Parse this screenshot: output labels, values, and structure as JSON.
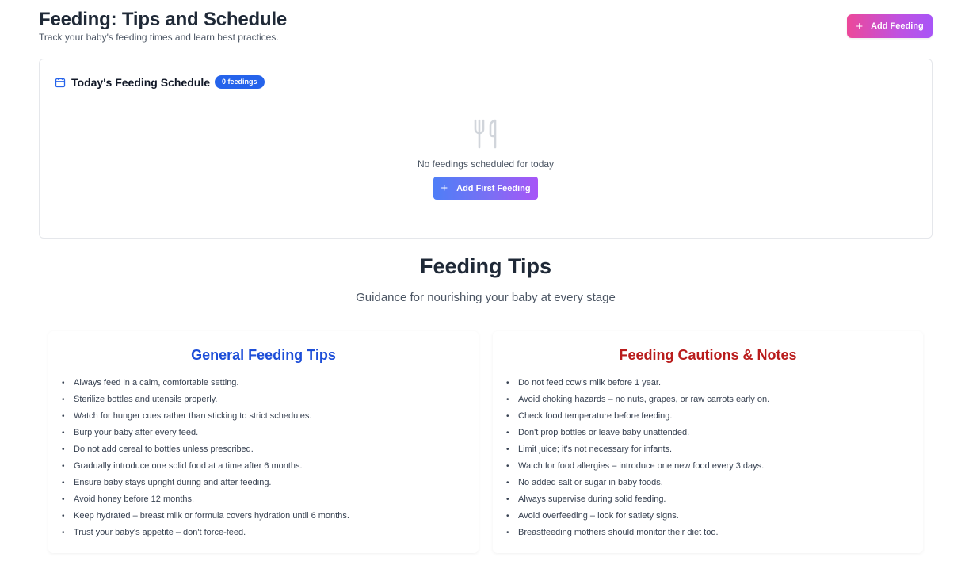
{
  "header": {
    "title": "Feeding: Tips and Schedule",
    "subtitle": "Track your baby's feeding times and learn best practices.",
    "add_button_label": "Add Feeding"
  },
  "schedule": {
    "title": "Today's Feeding Schedule",
    "badge": "0 feedings",
    "empty_text": "No feedings scheduled for today",
    "add_first_label": "Add First Feeding"
  },
  "tips": {
    "title": "Feeding Tips",
    "subtitle": "Guidance for nourishing your baby at every stage"
  },
  "general": {
    "title": "General Feeding Tips",
    "items": [
      "Always feed in a calm, comfortable setting.",
      "Sterilize bottles and utensils properly.",
      "Watch for hunger cues rather than sticking to strict schedules.",
      "Burp your baby after every feed.",
      "Do not add cereal to bottles unless prescribed.",
      "Gradually introduce one solid food at a time after 6 months.",
      "Ensure baby stays upright during and after feeding.",
      "Avoid honey before 12 months.",
      "Keep hydrated – breast milk or formula covers hydration until 6 months.",
      "Trust your baby's appetite – don't force-feed."
    ]
  },
  "cautions": {
    "title": "Feeding Cautions & Notes",
    "items": [
      "Do not feed cow's milk before 1 year.",
      "Avoid choking hazards – no nuts, grapes, or raw carrots early on.",
      "Check food temperature before feeding.",
      "Don't prop bottles or leave baby unattended.",
      "Limit juice; it's not necessary for infants.",
      "Watch for food allergies – introduce one new food every 3 days.",
      "No added salt or sugar in baby foods.",
      "Always supervise during solid feeding.",
      "Avoid overfeeding – look for satiety signs.",
      "Breastfeeding mothers should monitor their diet too."
    ]
  },
  "icons": {
    "calendar": "calendar-icon",
    "utensils": "utensils-icon",
    "plus": "plus-icon"
  },
  "colors": {
    "primary_blue": "#2563eb",
    "general_title": "#1d4ed8",
    "cautions_title": "#b91c1c",
    "pink_gradient_start": "#ec4899",
    "purple_gradient_end": "#a855f7"
  }
}
